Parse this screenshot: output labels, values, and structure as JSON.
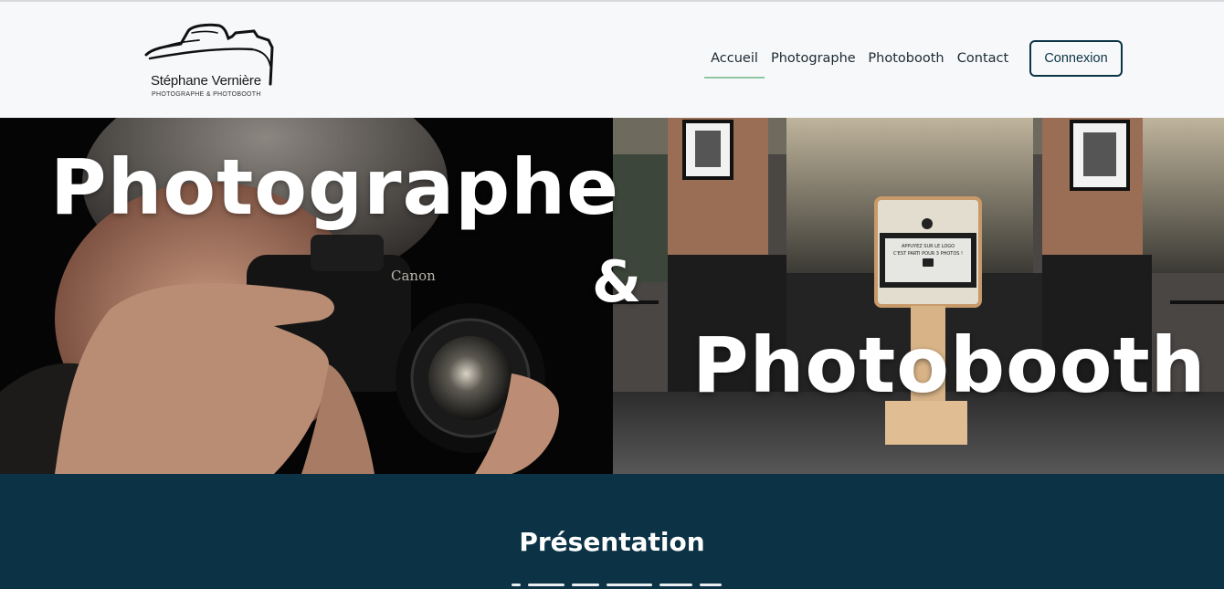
{
  "header": {
    "logo": {
      "name": "Stéphane Vernière",
      "tagline": "PHOTOGRAPHE & PHOTOBOOTH",
      "icon": "camera-outline-logo"
    },
    "nav": [
      {
        "label": "Accueil",
        "active": true
      },
      {
        "label": "Photographe",
        "active": false
      },
      {
        "label": "Photobooth",
        "active": false
      },
      {
        "label": "Contact",
        "active": false
      }
    ],
    "login_label": "Connexion"
  },
  "hero": {
    "title_left": "Photographe",
    "ampersand": "&",
    "title_right": "Photobooth",
    "booth_screen_line1": "APPUYEZ SUR LE LOGO",
    "booth_screen_line2": "C'EST PARTI POUR 3 PHOTOS !",
    "camera_brand": "Canon"
  },
  "presentation": {
    "title": "Présentation"
  },
  "colors": {
    "accent_dark": "#0c3345",
    "active_underline": "#8fc7a4",
    "header_bg": "#f7f8fa"
  }
}
